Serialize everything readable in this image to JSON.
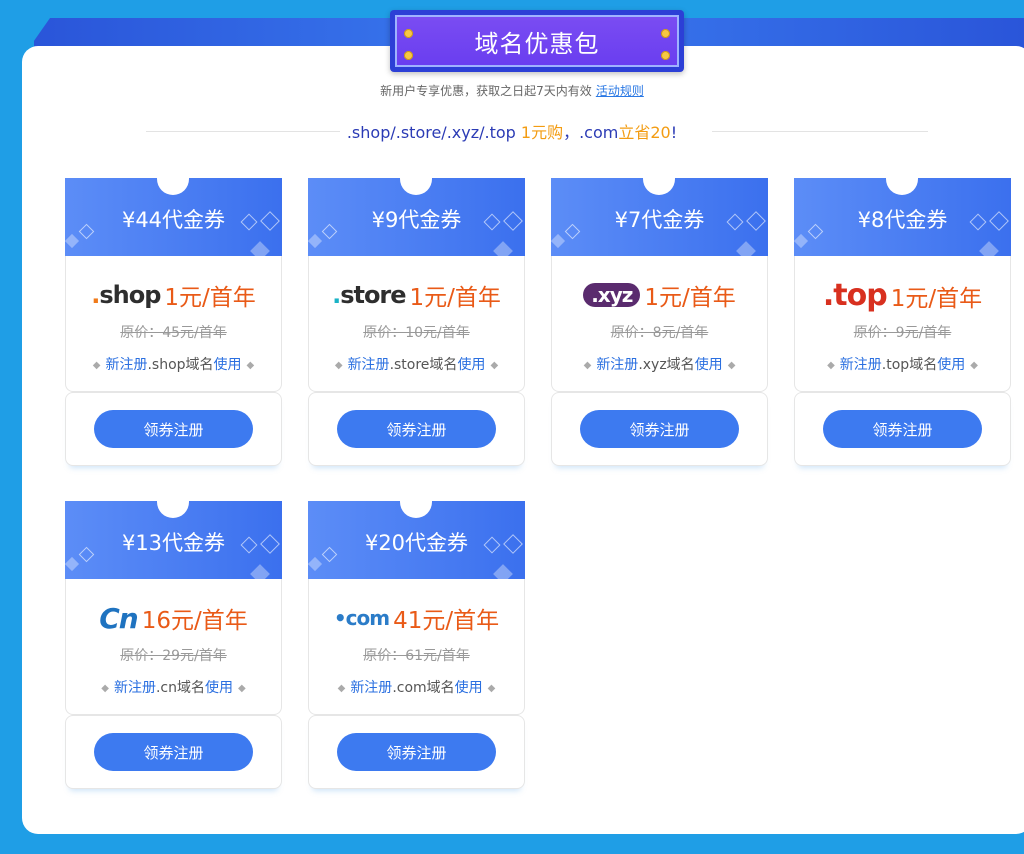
{
  "header": {
    "title": "域名优惠包",
    "subtitle": "新用户专享优惠，获取之日起7天内有效",
    "rules_link": "活动规则",
    "headline_part1": ".shop/.store/.xyz/.top ",
    "headline_part2": "1元购",
    "headline_part3": "，.com",
    "headline_part4": "立省20",
    "headline_part5": "!"
  },
  "cards": [
    {
      "coupon": "¥44代金券",
      "logo": "shop",
      "price": "1元/首年",
      "original": "原价：45元/首年",
      "desc_prefix": "新注册",
      "desc_domain": ".shop域名",
      "desc_suffix": "使用",
      "button": "领券注册"
    },
    {
      "coupon": "¥9代金券",
      "logo": "store",
      "price": "1元/首年",
      "original": "原价：10元/首年",
      "desc_prefix": "新注册",
      "desc_domain": ".store域名",
      "desc_suffix": "使用",
      "button": "领券注册"
    },
    {
      "coupon": "¥7代金券",
      "logo": "xyz",
      "price": "1元/首年",
      "original": "原价：8元/首年",
      "desc_prefix": "新注册",
      "desc_domain": ".xyz域名",
      "desc_suffix": "使用",
      "button": "领券注册"
    },
    {
      "coupon": "¥8代金券",
      "logo": "top",
      "price": "1元/首年",
      "original": "原价：9元/首年",
      "desc_prefix": "新注册",
      "desc_domain": ".top域名",
      "desc_suffix": "使用",
      "button": "领券注册"
    },
    {
      "coupon": "¥13代金券",
      "logo": "Cn",
      "price": "16元/首年",
      "original": "原价：29元/首年",
      "desc_prefix": "新注册",
      "desc_domain": ".cn域名",
      "desc_suffix": "使用",
      "button": "领券注册"
    },
    {
      "coupon": "¥20代金券",
      "logo": "com",
      "price": "41元/首年",
      "original": "原价：61元/首年",
      "desc_prefix": "新注册",
      "desc_domain": ".com域名",
      "desc_suffix": "使用",
      "button": "领券注册"
    }
  ],
  "colors": {
    "accent": "#3d7af0",
    "price": "#e95a17",
    "highlight": "#f39c12",
    "background": "#1f9ee6"
  }
}
